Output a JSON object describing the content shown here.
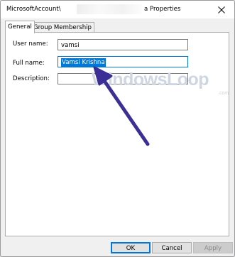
{
  "window": {
    "title_prefix": "MicrosoftAccount\\",
    "title_suffix": "a Properties",
    "close_icon": "close-icon"
  },
  "tabs": [
    {
      "label": "General",
      "active": true
    },
    {
      "label": "Group Membership",
      "active": false
    }
  ],
  "form": {
    "user_name": {
      "label": "User name:",
      "value": "vamsi"
    },
    "full_name": {
      "label": "Full name:",
      "value": "Vamsi Krishna"
    },
    "description": {
      "label": "Description:",
      "value": ""
    }
  },
  "watermark": {
    "main": "WindowsLoop",
    "suffix": ".com"
  },
  "annotation": {
    "arrow_color": "#3b2f96"
  },
  "buttons": {
    "ok": "OK",
    "cancel": "Cancel",
    "apply": "Apply"
  },
  "colors": {
    "accent": "#0078d7",
    "dialog_bg": "#f0f0f0",
    "panel_bg": "#ffffff"
  }
}
